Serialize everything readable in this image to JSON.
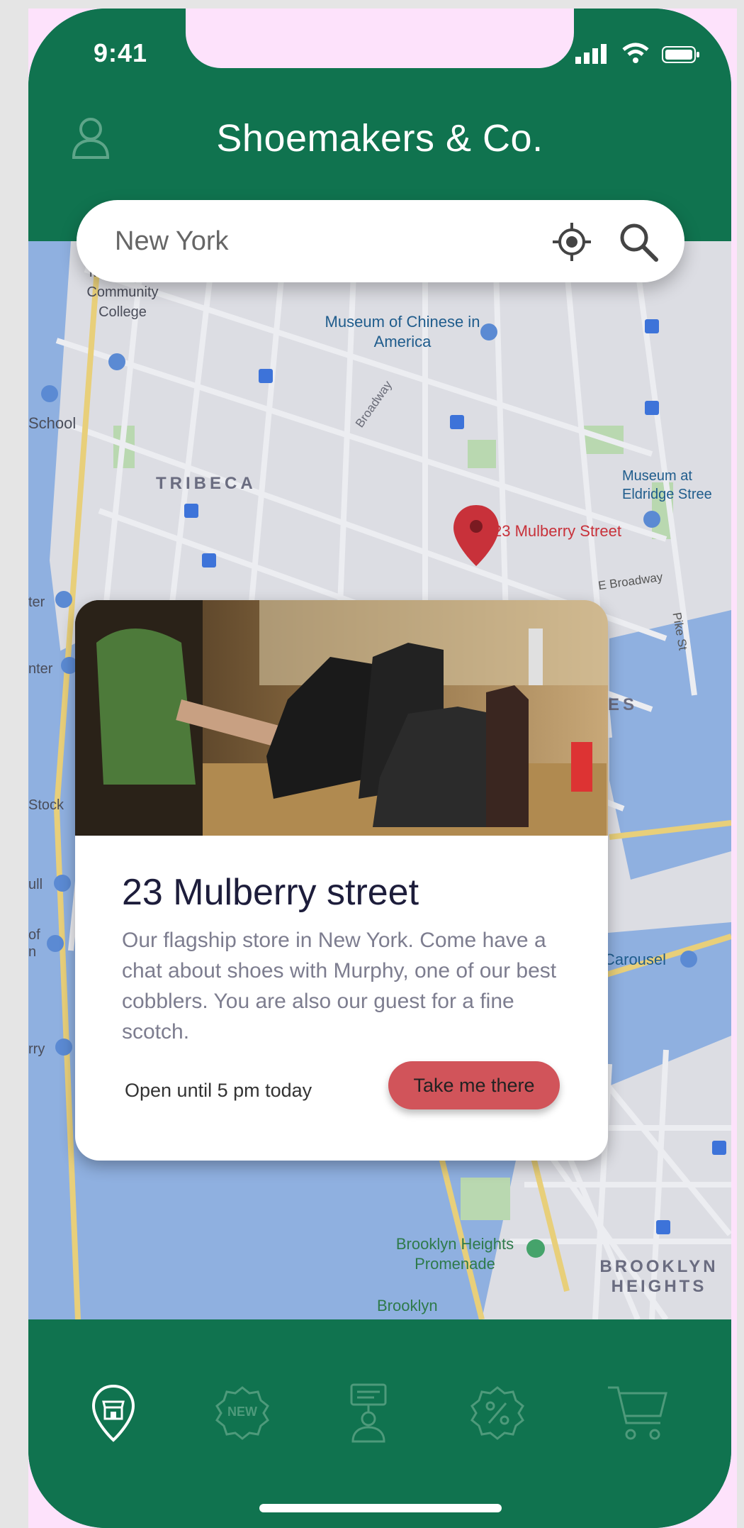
{
  "status": {
    "time": "9:41"
  },
  "header": {
    "title": "Shoemakers & Co.",
    "profile_icon": "user-icon"
  },
  "search": {
    "value": "New York",
    "locate_icon": "crosshair-icon",
    "search_icon": "search-icon"
  },
  "map": {
    "labels": {
      "bmcc": "Manhattan Community College",
      "museum_chinese": "Museum of Chinese in America",
      "broadway": "Broadway",
      "school": "School",
      "tribeca": "TRIBECA",
      "museum_eldridge": "Museum at Eldridge Stree",
      "pin": "23 Mulberry Street",
      "e_broadway": "E Broadway",
      "pike": "Pike St",
      "es": "ES",
      "stock": "Stock",
      "ull": "ull",
      "carousel": "Carousel",
      "rry": "rry",
      "ter": "ter",
      "nter": "nter",
      "of_n": "of n",
      "promenade": "Brooklyn Heights Promenade",
      "brooklyn": "Brooklyn",
      "brooklyn_heights": "BROOKLYN HEIGHTS"
    }
  },
  "card": {
    "title": "23 Mulberry street",
    "description": "Our flagship store in New York. Come have a chat about shoes with Murphy, one of our best cobblers. You are also our guest for a fine scotch.",
    "hours": "Open until 5 pm today",
    "cta": "Take me there"
  },
  "bottom_nav": {
    "items": [
      {
        "icon": "store-location-icon",
        "active": true
      },
      {
        "icon": "new-badge-icon",
        "active": false
      },
      {
        "icon": "kiosk-person-icon",
        "active": false
      },
      {
        "icon": "discount-icon",
        "active": false
      },
      {
        "icon": "cart-icon",
        "active": false
      }
    ],
    "new_badge_text": "NEW"
  },
  "colors": {
    "brand_green": "#10734f",
    "accent_red": "#d1545a",
    "map_water": "#8fb0e0",
    "map_land": "#dcdde3"
  }
}
